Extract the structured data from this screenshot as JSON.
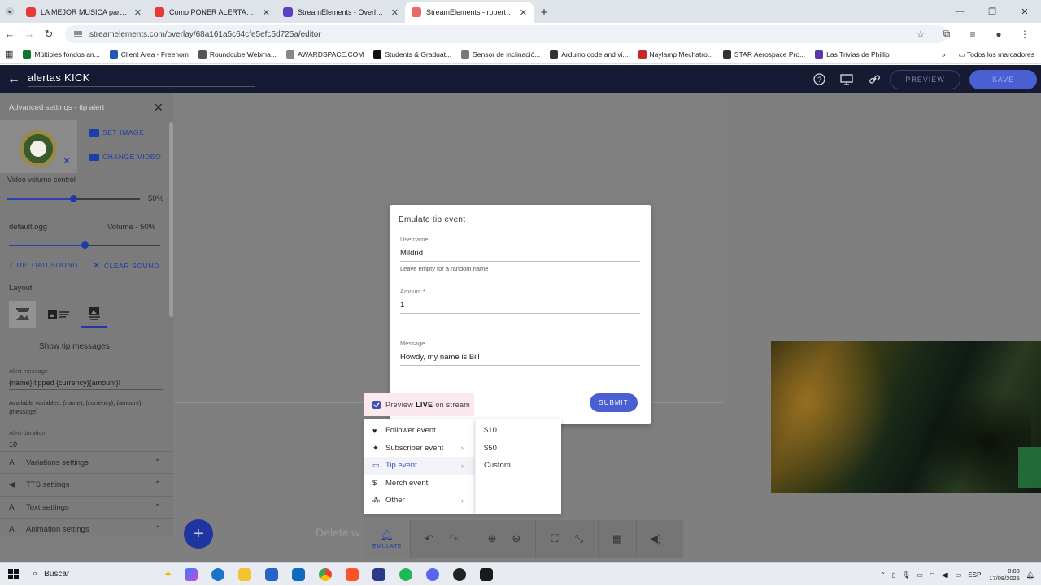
{
  "browser": {
    "tabs": [
      {
        "title": "LA MEJOR MUSICA para STI",
        "color": "#e53935",
        "active": false
      },
      {
        "title": "Como PONER ALERTAS de KICK",
        "color": "#e53935",
        "active": false
      },
      {
        "title": "StreamElements - Overlays",
        "color": "#5b3fc9",
        "active": false
      },
      {
        "title": "StreamElements - robertplsy",
        "color": "#e86a6a",
        "active": true
      }
    ],
    "url": "streamelements.com/overlay/68a161a5c64cfe5efc5d725a/editor",
    "bookmarks": [
      {
        "label": "Múltiples fondos an...",
        "color": "#0a7a2a"
      },
      {
        "label": "Client Area - Freenom",
        "color": "#2456b3"
      },
      {
        "label": "Roundcube Webma...",
        "color": "#555"
      },
      {
        "label": "AWARDSPACE.COM",
        "color": "#888"
      },
      {
        "label": "Students & Graduat...",
        "color": "#111"
      },
      {
        "label": "Sensor de inclinació...",
        "color": "#777"
      },
      {
        "label": "Arduino code and vi...",
        "color": "#333"
      },
      {
        "label": "Naylamp Mechatro...",
        "color": "#c62828"
      },
      {
        "label": "STAR Aerospace Pro...",
        "color": "#333"
      },
      {
        "label": "Las Trivias de Phillip",
        "color": "#5e35b1"
      }
    ],
    "all_bookmarks": "Todos los marcadores"
  },
  "header": {
    "title": "alertas KICK",
    "preview_label": "PREVIEW",
    "save_label": "SAVE"
  },
  "panel": {
    "heading": "Advanced settings - tip alert",
    "set_image": "SET IMAGE",
    "change_video": "CHANGE VIDEO",
    "video_volume_label": "Video volume control",
    "video_volume_value": "50%",
    "video_volume": 0.5,
    "sound_file": "default.ogg",
    "sound_volume_label": "Volume - 50%",
    "sound_volume": 0.5,
    "upload_sound": "UPLOAD SOUND",
    "clear_sound": "CLEAR SOUND",
    "layout_label": "Layout",
    "show_tip_messages": "Show tip messages",
    "alert_message_label": "Alert message",
    "alert_message_value": "{name} tipped {currency}{amount}!",
    "available_vars": "Available variables: {name}, {currency}, {amount}, {message}",
    "alert_duration_label": "Alert duration",
    "alert_duration_value": "10",
    "sections": [
      "Variations settings",
      "TTS settings",
      "Text settings",
      "Animation settings"
    ]
  },
  "dialog": {
    "title": "Emulate tip event",
    "username_label": "Username",
    "username_value": "Mildrid",
    "username_help": "Leave empty for a random name",
    "amount_label": "Amount *",
    "amount_value": "1",
    "message_label": "Message",
    "message_value": "Howdy, my name is Bill",
    "submit_label": "SUBMIT"
  },
  "live_chip": {
    "prefix": "Preview",
    "bold": "LIVE",
    "suffix": "on stream"
  },
  "emulate_menu": {
    "items": [
      {
        "label": "Follower event",
        "icon": "heart-icon",
        "glyph": "♥",
        "submenu": false
      },
      {
        "label": "Subscriber event",
        "icon": "star-person-icon",
        "glyph": "✦",
        "submenu": true
      },
      {
        "label": "Tip event",
        "icon": "card-icon",
        "glyph": "▭",
        "submenu": true
      },
      {
        "label": "Merch event",
        "icon": "dollar-icon",
        "glyph": "$",
        "submenu": false
      },
      {
        "label": "Other",
        "icon": "dots-icon",
        "glyph": "⁂",
        "submenu": true
      }
    ],
    "highlighted": 2,
    "tip_submenu": [
      "$10",
      "$50",
      "Custom..."
    ]
  },
  "toolbar": {
    "emulate_label": "EMULATE",
    "ghost_text": "Delete w"
  },
  "taskbar": {
    "search_placeholder": "Buscar",
    "lang": "ESP",
    "time": "0:08",
    "date": "17/08/2025"
  }
}
